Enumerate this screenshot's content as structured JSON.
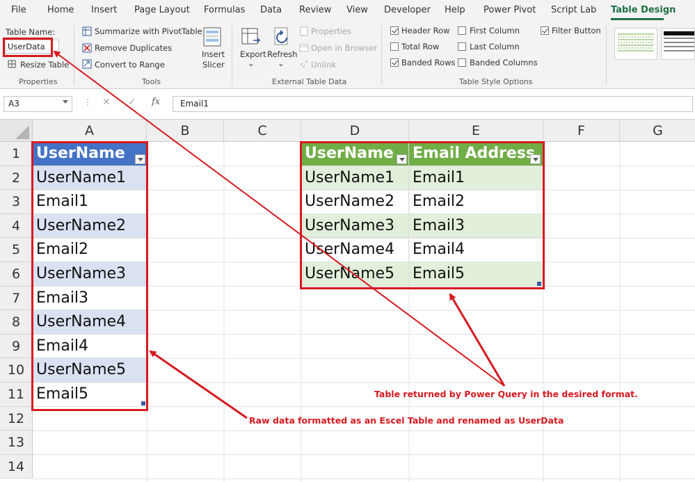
{
  "menu": {
    "tabs": [
      "File",
      "Home",
      "Insert",
      "Page Layout",
      "Formulas",
      "Data",
      "Review",
      "View",
      "Developer",
      "Help",
      "Power Pivot",
      "Script Lab",
      "Table Design"
    ],
    "active_tab": "Table Design"
  },
  "ribbon": {
    "properties": {
      "table_name_label": "Table Name:",
      "table_name_value": "UserData",
      "resize_label": "Resize Table",
      "group_label": "Properties"
    },
    "tools": {
      "summarize_label": "Summarize with PivotTable",
      "remove_duplicates_label": "Remove Duplicates",
      "convert_label": "Convert to Range",
      "insert_slicer_label_1": "Insert",
      "insert_slicer_label_2": "Slicer",
      "group_label": "Tools"
    },
    "external": {
      "export_label": "Export",
      "refresh_label": "Refresh",
      "properties_label": "Properties",
      "open_browser_label": "Open in Browser",
      "unlink_label": "Unlink",
      "group_label": "External Table Data"
    },
    "style_options": {
      "header_row": {
        "label": "Header Row",
        "checked": true
      },
      "total_row": {
        "label": "Total Row",
        "checked": false
      },
      "banded_rows": {
        "label": "Banded Rows",
        "checked": true
      },
      "first_column": {
        "label": "First Column",
        "checked": false
      },
      "last_column": {
        "label": "Last Column",
        "checked": false
      },
      "banded_columns": {
        "label": "Banded Columns",
        "checked": false
      },
      "filter_button": {
        "label": "Filter Button",
        "checked": true
      },
      "group_label": "Table Style Options"
    }
  },
  "formula_bar": {
    "name_box": "A3",
    "fx_label": "fx",
    "content": "Email1"
  },
  "sheet": {
    "columns": [
      "A",
      "B",
      "C",
      "D",
      "E",
      "F",
      "G"
    ],
    "rows": [
      "1",
      "2",
      "3",
      "4",
      "5",
      "6",
      "7",
      "8",
      "9",
      "10",
      "11",
      "12",
      "13",
      "14"
    ],
    "table_left": {
      "header": "UserName",
      "cells": [
        "UserName1",
        "Email1",
        "UserName2",
        "Email2",
        "UserName3",
        "Email3",
        "UserName4",
        "Email4",
        "UserName5",
        "Email5"
      ]
    },
    "table_right": {
      "headers": [
        "UserName",
        "Email Address"
      ],
      "rows": [
        [
          "UserName1",
          "Email1"
        ],
        [
          "UserName2",
          "Email2"
        ],
        [
          "UserName3",
          "Email3"
        ],
        [
          "UserName4",
          "Email4"
        ],
        [
          "UserName5",
          "Email5"
        ]
      ]
    }
  },
  "annotations": {
    "right_table_note": "Table returned by Power Query in the desired format.",
    "left_table_note": "Raw data formatted as an Escel Table and renamed as UserData",
    "color": "#d71920"
  },
  "colors": {
    "blue_header": "#4472c4",
    "blue_band": "#d9e1f2",
    "green_header": "#70ad47",
    "green_band": "#e2efda",
    "active_tab": "#1e7145"
  }
}
